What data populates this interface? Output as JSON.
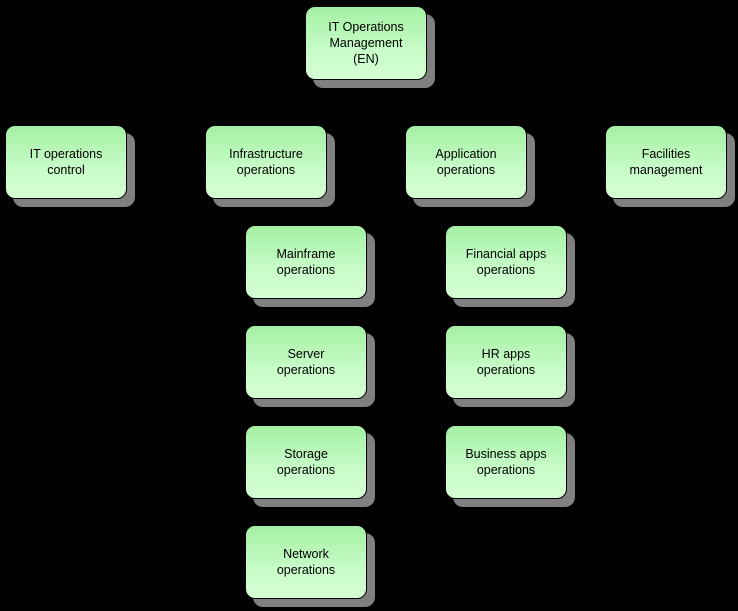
{
  "diagram": {
    "type": "org-chart",
    "root": {
      "label": "IT Operations\nManagement\n(EN)"
    },
    "level2": [
      {
        "label": "IT operations\ncontrol"
      },
      {
        "label": "Infrastructure\noperations"
      },
      {
        "label": "Application\noperations"
      },
      {
        "label": "Facilities\nmanagement"
      }
    ],
    "infrastructure_children": [
      {
        "label": "Mainframe\noperations"
      },
      {
        "label": "Server\noperations"
      },
      {
        "label": "Storage\noperations"
      },
      {
        "label": "Network\noperations"
      }
    ],
    "application_children": [
      {
        "label": "Financial apps\noperations"
      },
      {
        "label": "HR apps\noperations"
      },
      {
        "label": "Business apps\noperations"
      }
    ],
    "colors": {
      "box_fill_top": "#a4f0a4",
      "box_fill_bottom": "#d4ffd4",
      "shadow": "#808080",
      "background": "#000000"
    }
  }
}
